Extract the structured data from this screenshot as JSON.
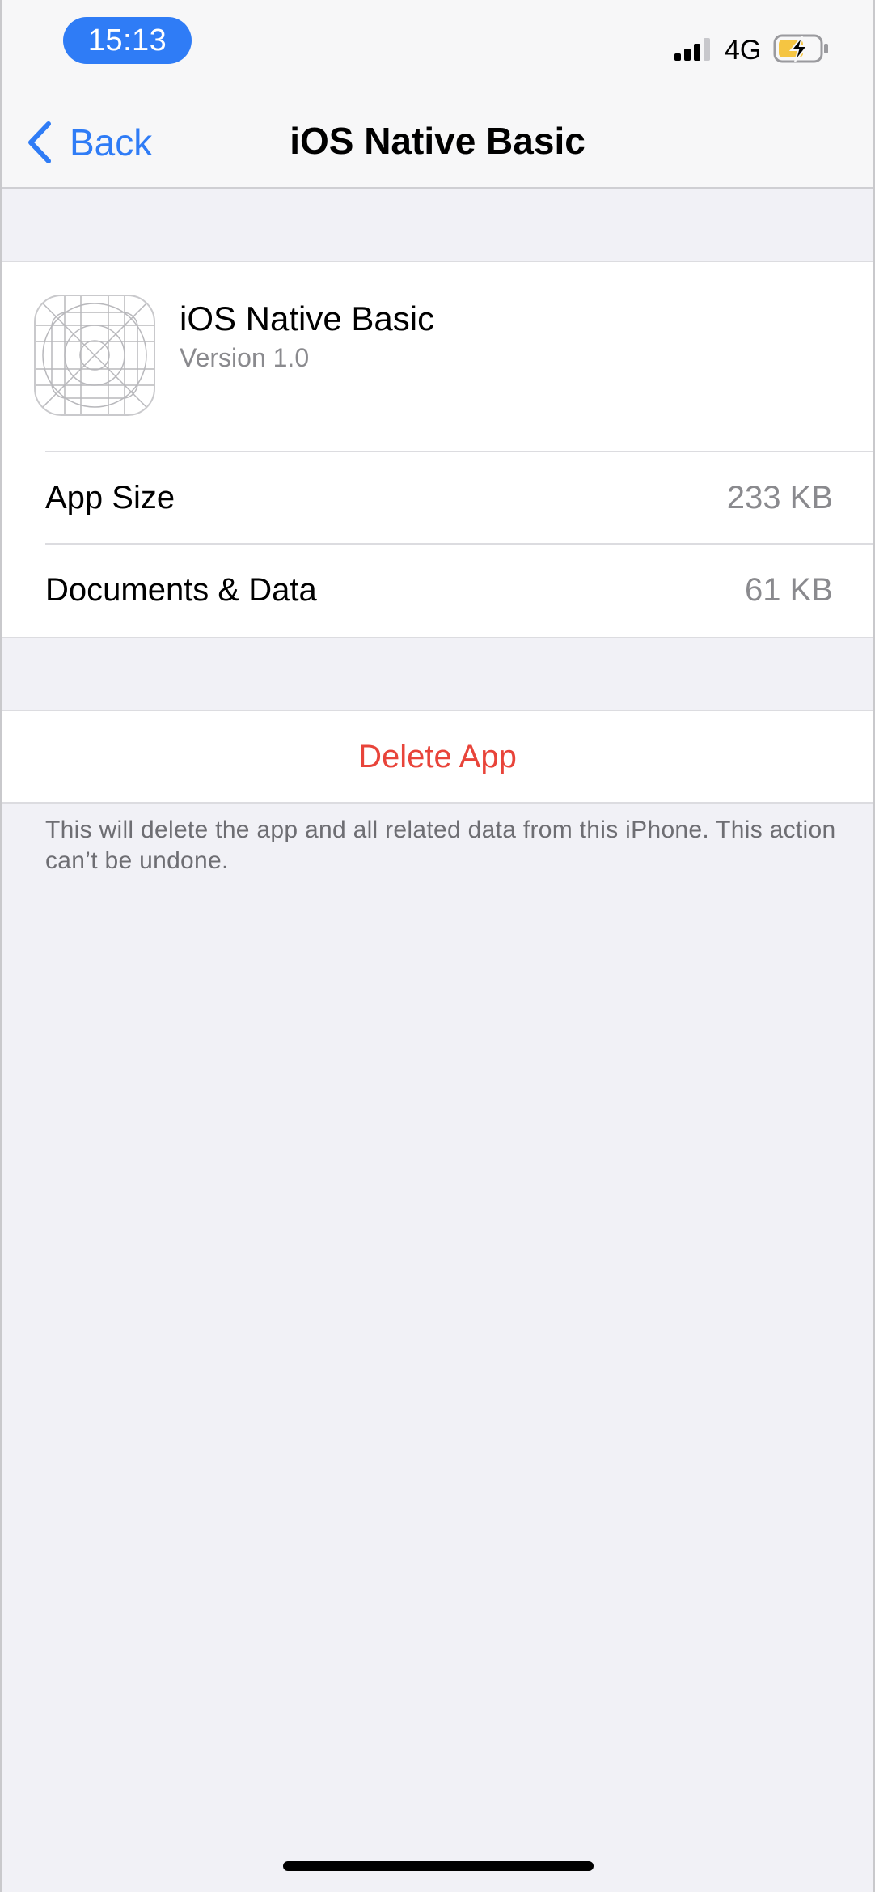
{
  "status_bar": {
    "time": "15:13",
    "network": "4G",
    "icons": [
      "signal-bars-icon",
      "battery-charging-icon"
    ],
    "colors": {
      "time_pill": "#2f7cf6",
      "battery_fill": "#f5c542"
    }
  },
  "nav": {
    "back_label": "Back",
    "title": "iOS Native Basic",
    "icons": [
      "chevron-left-icon"
    ]
  },
  "app": {
    "name": "iOS Native Basic",
    "version": "Version 1.0",
    "icon": "app-placeholder-icon"
  },
  "storage": {
    "rows": [
      {
        "label": "App Size",
        "value": "233 KB"
      },
      {
        "label": "Documents & Data",
        "value": "61 KB"
      }
    ]
  },
  "delete": {
    "label": "Delete App",
    "note": "This will delete the app and all related data from this iPhone. This action can’t be undone.",
    "color": "#e8443a"
  }
}
